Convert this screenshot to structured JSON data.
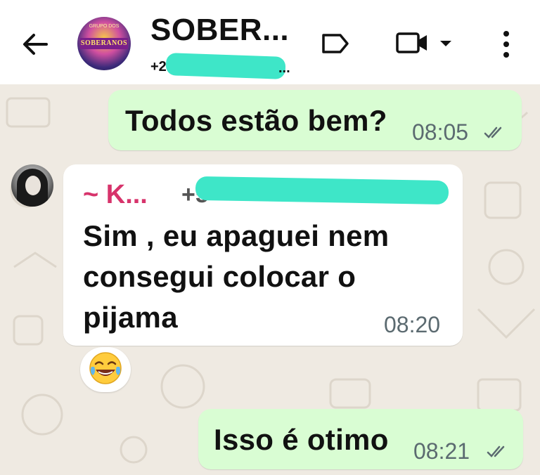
{
  "header": {
    "title": "SOBER...",
    "subtitle_prefix": "+2",
    "subtitle_suffix": "...",
    "group_avatar_text": "SOBERANOS",
    "group_avatar_toptext": "GRUPO DOS"
  },
  "icons": {
    "back": "arrow-left",
    "label": "tag",
    "video": "video-camera",
    "caret": "caret-down",
    "more": "more-vertical"
  },
  "messages": [
    {
      "direction": "outgoing",
      "text": "Todos estão bem?",
      "time": "08:05",
      "status": "read"
    },
    {
      "direction": "incoming",
      "sender": "~ K...",
      "sender_phone_prefix": "+5",
      "lines": [
        "Sim , eu apaguei nem",
        "consegui colocar o",
        "pijama"
      ],
      "time": "08:20",
      "reaction": "face-with-tears-of-joy"
    },
    {
      "direction": "outgoing",
      "text": "Isso é otimo",
      "time": "08:21",
      "status": "read"
    }
  ],
  "colors": {
    "outgoing_bubble": "#d9fdd3",
    "incoming_bubble": "#ffffff",
    "sender_name": "#d7336b",
    "chat_bg": "#efeae2"
  }
}
